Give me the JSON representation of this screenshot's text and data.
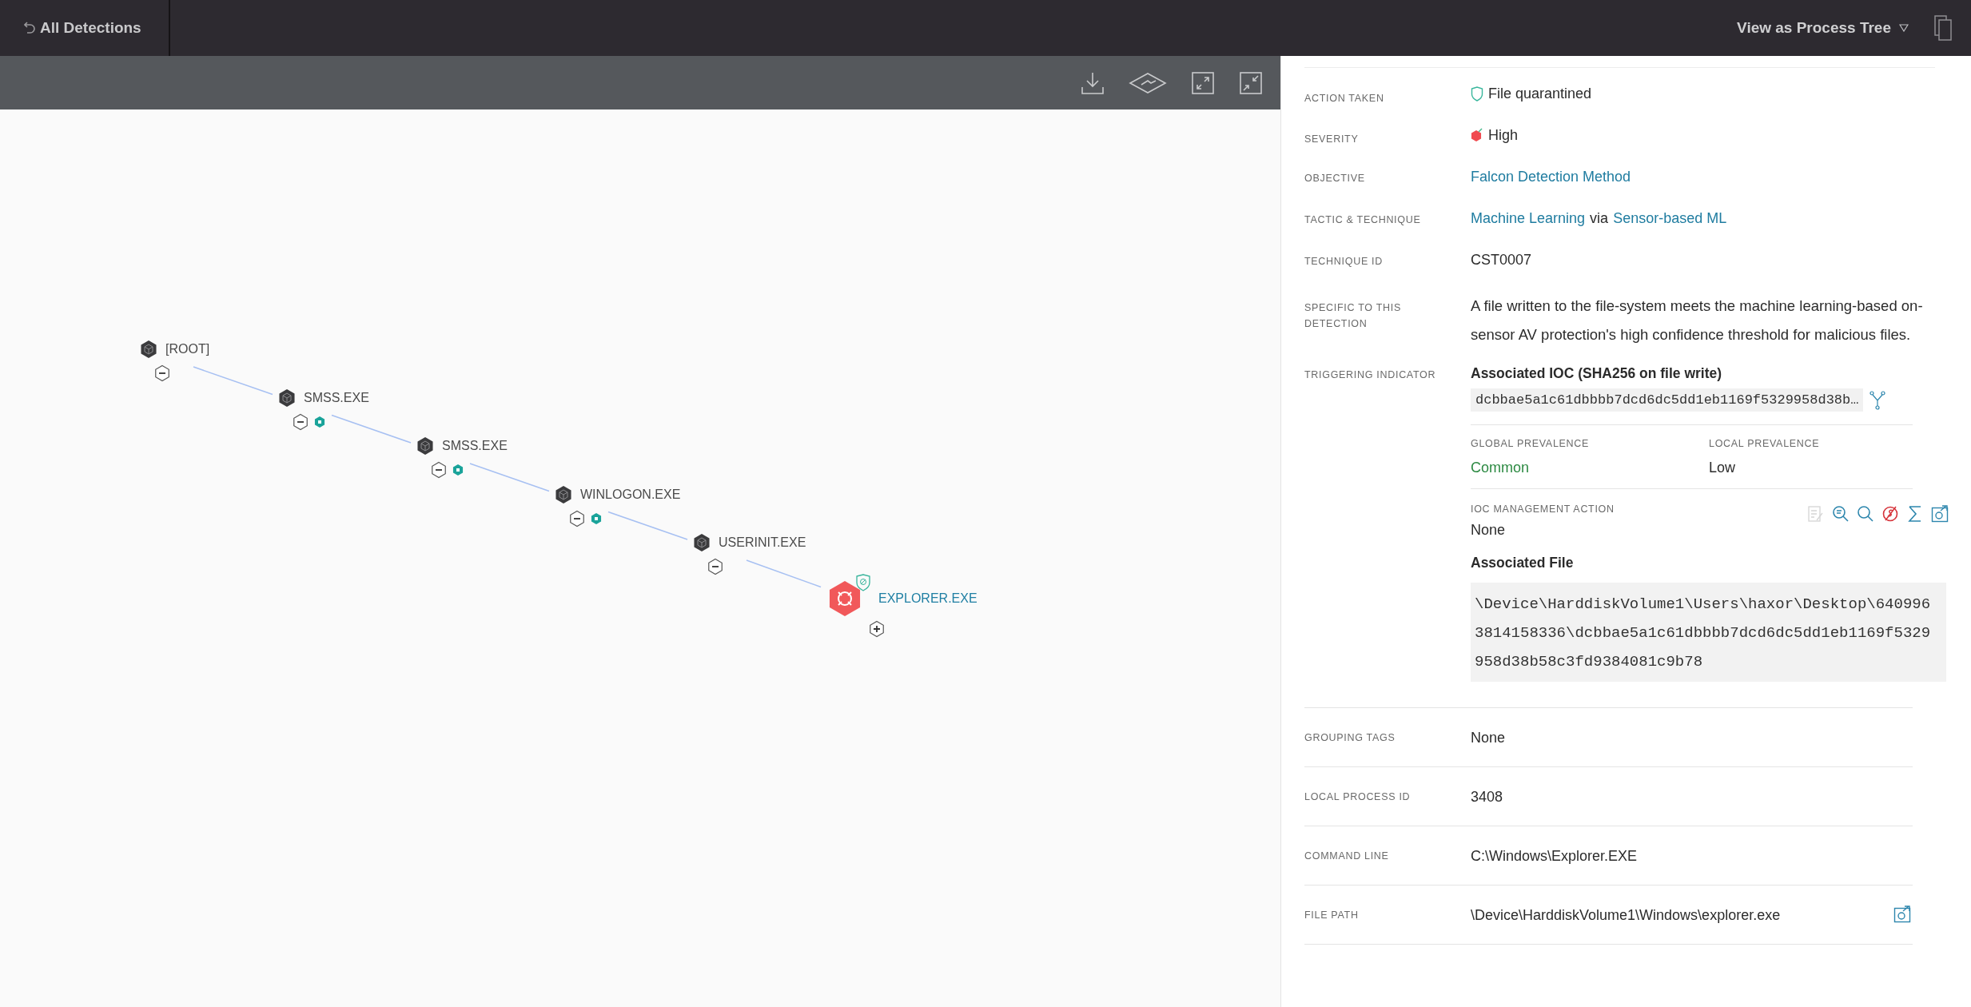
{
  "top_bar": {
    "back_link": "All Detections",
    "view_menu": "View as Process Tree"
  },
  "process_tree": {
    "root": {
      "label": "[ROOT]",
      "kind": "process",
      "expanded": true,
      "badge": false,
      "quarantined": false,
      "selected": false,
      "children": [
        {
          "label": "SMSS.EXE",
          "kind": "process",
          "expanded": true,
          "badge": true,
          "quarantined": false,
          "selected": false,
          "children": [
            {
              "label": "SMSS.EXE",
              "kind": "process",
              "expanded": true,
              "badge": true,
              "quarantined": false,
              "selected": false,
              "children": [
                {
                  "label": "WINLOGON.EXE",
                  "kind": "process",
                  "expanded": true,
                  "badge": true,
                  "quarantined": false,
                  "selected": false,
                  "children": [
                    {
                      "label": "USERINIT.EXE",
                      "kind": "process",
                      "expanded": true,
                      "badge": false,
                      "quarantined": false,
                      "selected": false,
                      "children": [
                        {
                          "label": "EXPLORER.EXE",
                          "kind": "detection",
                          "expanded": false,
                          "badge": false,
                          "quarantined": true,
                          "selected": true
                        }
                      ]
                    }
                  ]
                }
              ]
            }
          ]
        }
      ]
    }
  },
  "details": {
    "rows": [
      {
        "label": "ACTION TAKEN",
        "kind": "quarantine",
        "value": "File quarantined"
      },
      {
        "label": "SEVERITY",
        "kind": "severity",
        "value": "High"
      },
      {
        "label": "OBJECTIVE",
        "kind": "link",
        "value": "Falcon Detection Method"
      },
      {
        "label": "TACTIC & TECHNIQUE",
        "kind": "mixed",
        "parts": [
          {
            "text": "Machine Learning",
            "link": true
          },
          {
            "text": "via",
            "link": false
          },
          {
            "text": "Sensor-based ML",
            "link": true
          }
        ]
      },
      {
        "label": "TECHNIQUE ID",
        "kind": "text",
        "value": "CST0007"
      },
      {
        "label": "SPECIFIC TO THIS DETECTION",
        "kind": "paragraph",
        "value": "A file written to the file-system meets the machine learning-based on-sensor AV protection's high confidence threshold for malicious files."
      }
    ],
    "triggering": {
      "label": "TRIGGERING INDICATOR",
      "ioc_title": "Associated IOC (SHA256 on file write)",
      "ioc_hash": "dcbbae5a1c61dbbbb7dcd6dc5dd1eb1169f5329958d38b…",
      "global_prevalence": {
        "label": "GLOBAL PREVALENCE",
        "value": "Common"
      },
      "local_prevalence": {
        "label": "LOCAL PREVALENCE",
        "value": "Low"
      },
      "ioc_management": {
        "label": "IOC MANAGEMENT ACTION",
        "value": "None",
        "actions": [
          {
            "kind": "note",
            "disabled": true
          },
          {
            "kind": "filter-search",
            "disabled": false
          },
          {
            "kind": "search",
            "disabled": false
          },
          {
            "kind": "blocked",
            "disabled": false
          },
          {
            "kind": "sigma",
            "disabled": false
          },
          {
            "kind": "graph",
            "disabled": false
          }
        ]
      },
      "file_title": "Associated File",
      "file_path": "\\Device\\HarddiskVolume1\\Users\\haxor\\Desktop\\6409963814158336\\dcbbae5a1c61dbbbb7dcd6dc5dd1eb1169f5329958d38b58c3fd9384081c9b78"
    },
    "lower_rows": [
      {
        "label": "GROUPING TAGS",
        "kind": "text",
        "value": "None"
      },
      {
        "label": "LOCAL PROCESS ID",
        "kind": "text",
        "value": "3408"
      },
      {
        "label": "COMMAND LINE",
        "kind": "text",
        "value": "C:\\Windows\\Explorer.EXE"
      },
      {
        "label": "FILE PATH",
        "kind": "path",
        "value": "\\Device\\HarddiskVolume1\\Windows\\explorer.exe"
      }
    ]
  }
}
